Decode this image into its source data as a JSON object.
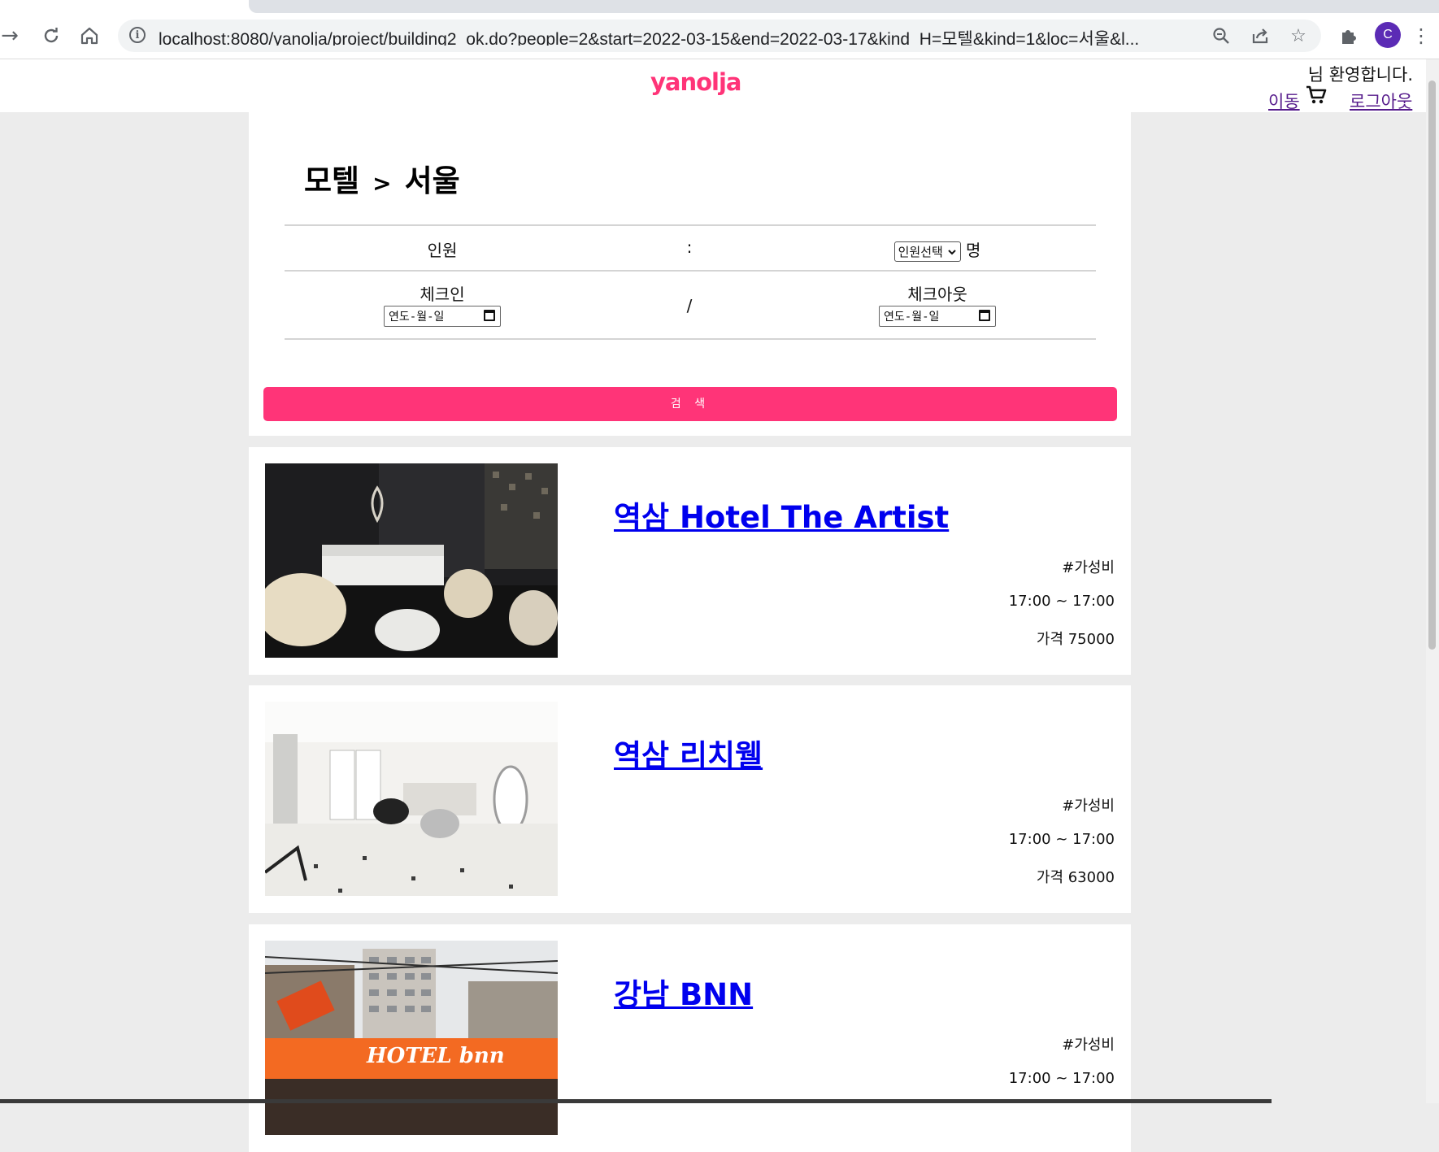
{
  "browser": {
    "url": "localhost:8080/yanolja/project/building2_ok.do?people=2&start=2022-03-15&end=2022-03-17&kind_H=모텔&kind=1&loc=서울&l...",
    "profile_initial": "C"
  },
  "header": {
    "logo": "yanolja",
    "welcome": "님 환영합니다.",
    "move_link": "이동",
    "logout_link": "로그아웃"
  },
  "search": {
    "breadcrumb_kind": "모텔",
    "breadcrumb_sep": ">",
    "breadcrumb_loc": "서울",
    "people_label": "인원",
    "people_sep": ":",
    "people_select": "인원선택",
    "people_unit": "명",
    "checkin_label": "체크인",
    "date_sep": "/",
    "checkout_label": "체크아웃",
    "date_placeholder": "연도-월-일",
    "button_label": "검 색"
  },
  "listings": [
    {
      "name": "역삼 Hotel The Artist",
      "tag": "#가성비",
      "hours": "17:00 ~ 17:00",
      "price": "가격 75000"
    },
    {
      "name": "역삼 리치웰",
      "tag": "#가성비",
      "hours": "17:00 ~ 17:00",
      "price": "가격 63000"
    },
    {
      "name": "강남 BNN",
      "tag": "#가성비",
      "hours": "17:00 ~ 17:00",
      "price": ""
    }
  ],
  "colors": {
    "brand": "#ff3478",
    "link": "#0000ee",
    "visited": "#551a8b",
    "page_bg": "#ececec"
  }
}
